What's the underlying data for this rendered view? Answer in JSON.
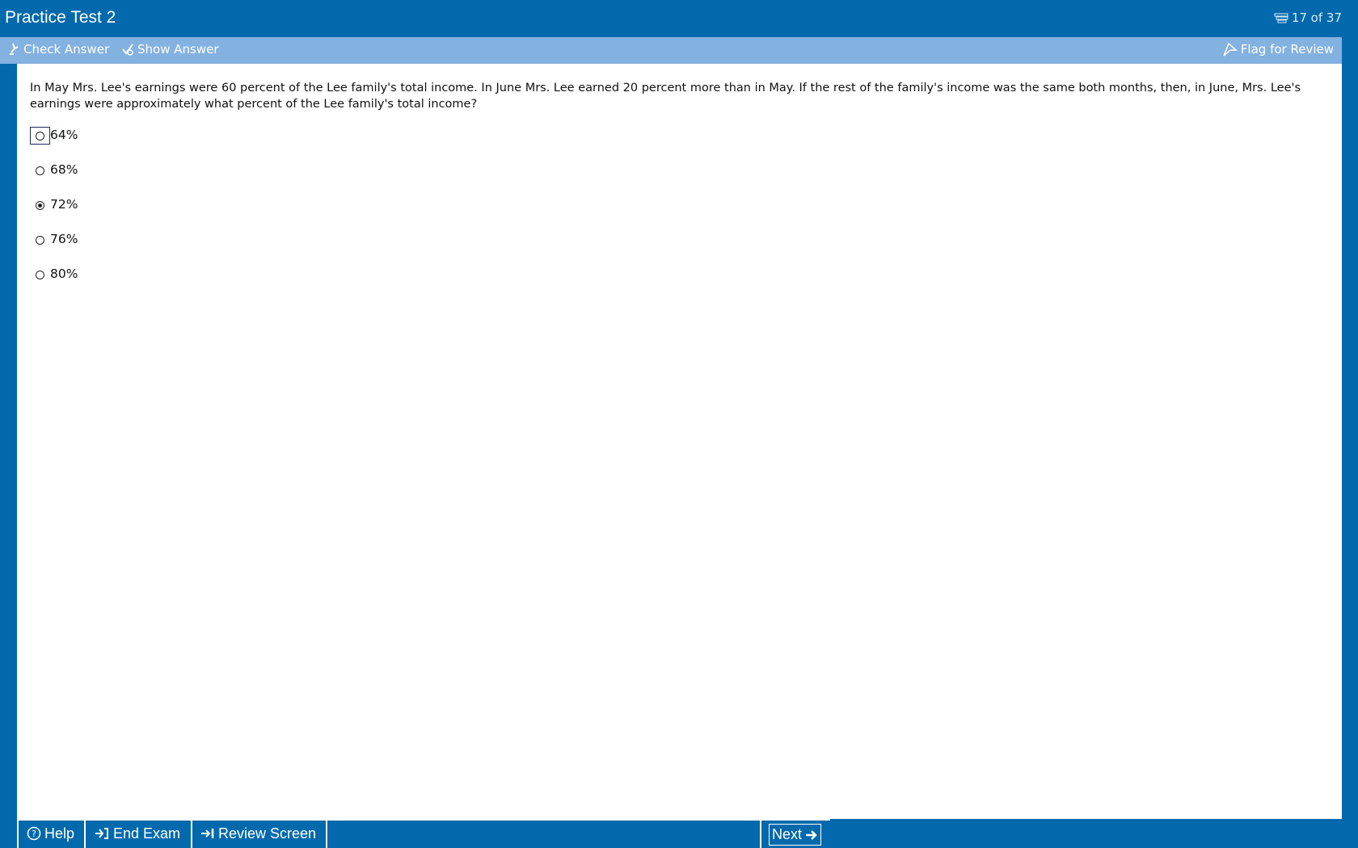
{
  "window": {
    "title": "Practice Test 2",
    "progress": "17 of 37",
    "progress_icon": "list-icon"
  },
  "toolbar": {
    "check_answer": "Check Answer",
    "show_answer": "Show Answer",
    "flag_for_review": "Flag for Review"
  },
  "question": {
    "text": "In May Mrs. Lee's earnings were 60 percent of the Lee family's total income.  In June Mrs. Lee earned 20 percent more than in May.  If the rest of the family's income was the same both months, then, in June, Mrs. Lee's earnings were approximately what percent of the Lee family's total income?",
    "choices": [
      {
        "label": "64%",
        "selected": false,
        "focused": true
      },
      {
        "label": "68%",
        "selected": false,
        "focused": false
      },
      {
        "label": "72%",
        "selected": true,
        "focused": false
      },
      {
        "label": "76%",
        "selected": false,
        "focused": false
      },
      {
        "label": "80%",
        "selected": false,
        "focused": false
      }
    ]
  },
  "bottom": {
    "help": "Help",
    "end_exam": "End Exam",
    "review_screen": "Review Screen",
    "next": "Next"
  },
  "colors": {
    "frame": "#0169ac",
    "toolbar": "#83b1e0",
    "content": "#ffffff"
  }
}
